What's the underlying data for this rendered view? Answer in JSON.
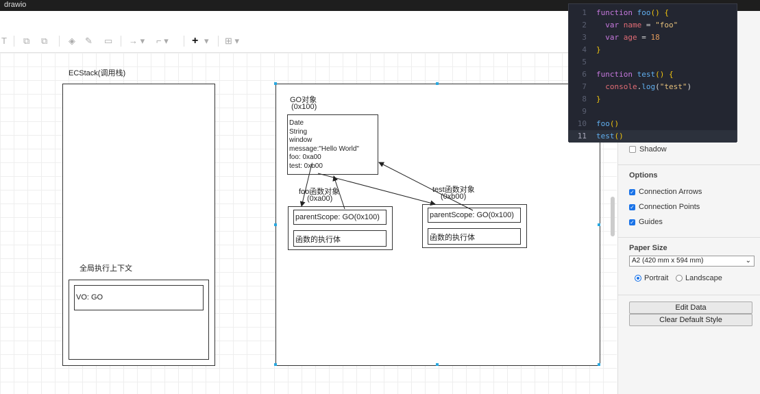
{
  "app": {
    "title": "drawio"
  },
  "diagram": {
    "ecstack_title": "ECStack(调用栈)",
    "global_ctx_label": "全局执行上下文",
    "vo_label": "VO: GO",
    "go_title_line1": "GO对象",
    "go_title_line2": "(0x100)",
    "go_props": [
      "Date",
      "String",
      "window",
      "message:\"Hello World\"",
      "foo: 0xa00",
      "test: 0xb00"
    ],
    "foo_title_line1": "foo函数对象",
    "foo_title_line2": "(0xa00)",
    "foo_parent_scope": "parentScope: GO(0x100)",
    "foo_body": "函数的执行体",
    "test_title_line1": "test函数对象",
    "test_title_line2": "(0xb00)",
    "test_parent_scope": "parentScope: GO(0x100)",
    "test_body": "函数的执行体"
  },
  "panel": {
    "shadow_label": "Shadow",
    "options_heading": "Options",
    "connection_arrows": "Connection Arrows",
    "connection_points": "Connection Points",
    "guides": "Guides",
    "paper_size_heading": "Paper Size",
    "paper_size_value": "A2 (420 mm x 594 mm)",
    "portrait": "Portrait",
    "landscape": "Landscape",
    "edit_data": "Edit Data",
    "clear_default_style": "Clear Default Style"
  },
  "code_lines": [
    {
      "n": "1",
      "t": "function foo() {"
    },
    {
      "n": "2",
      "t": "  var name = \"foo\""
    },
    {
      "n": "3",
      "t": "  var age = 18"
    },
    {
      "n": "4",
      "t": "}"
    },
    {
      "n": "5",
      "t": ""
    },
    {
      "n": "6",
      "t": "function test() {"
    },
    {
      "n": "7",
      "t": "  console.log(\"test\")"
    },
    {
      "n": "8",
      "t": "}"
    },
    {
      "n": "9",
      "t": ""
    },
    {
      "n": "10",
      "t": "foo()"
    },
    {
      "n": "11",
      "t": "test()"
    }
  ]
}
